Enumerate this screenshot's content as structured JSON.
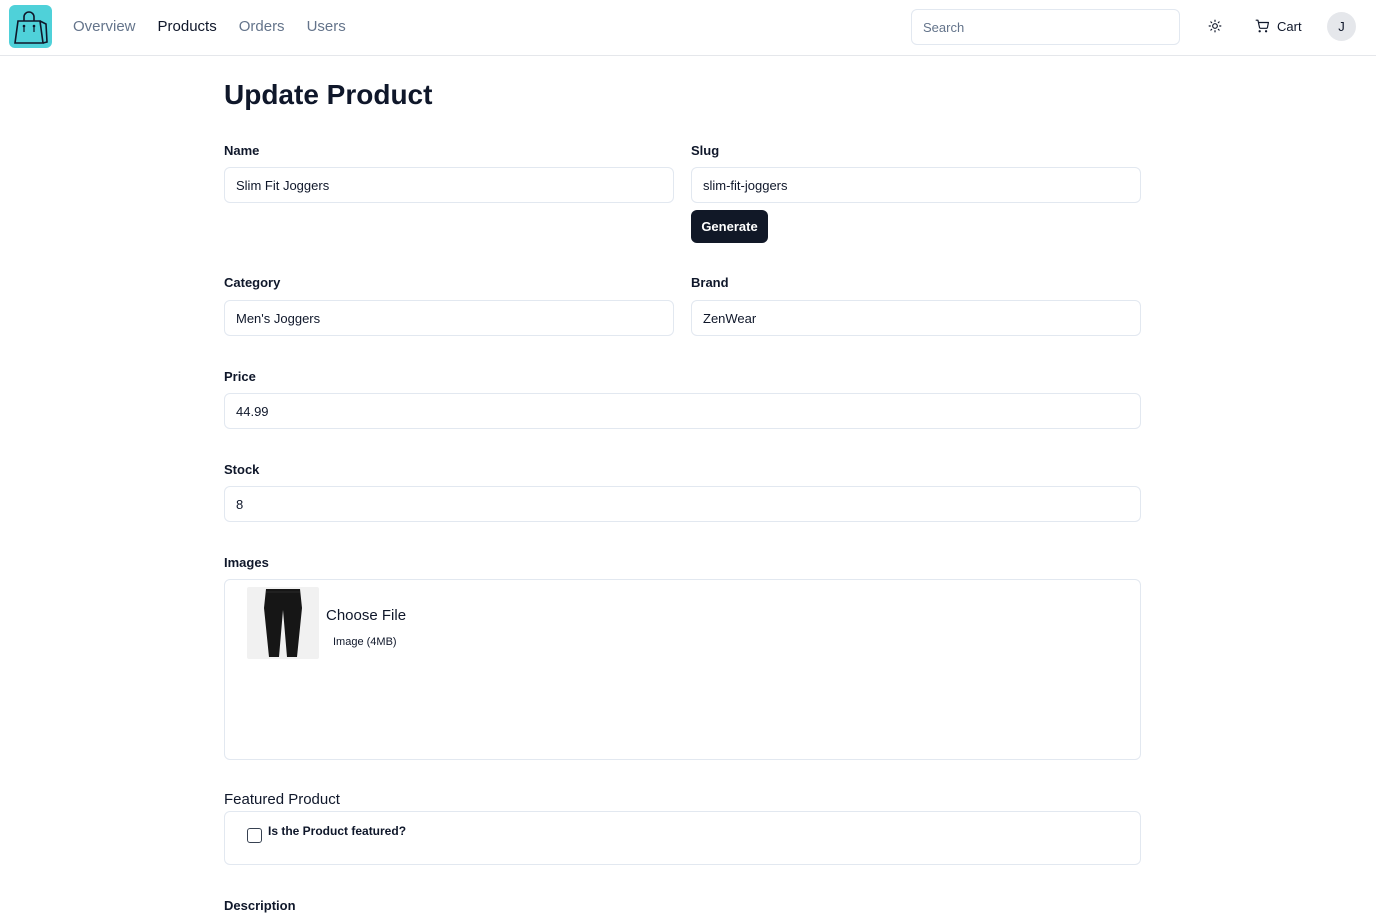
{
  "header": {
    "nav": [
      {
        "label": "Overview",
        "active": false
      },
      {
        "label": "Products",
        "active": true
      },
      {
        "label": "Orders",
        "active": false
      },
      {
        "label": "Users",
        "active": false
      }
    ],
    "search_placeholder": "Search",
    "cart_label": "Cart",
    "avatar_initial": "J",
    "logo_color": "#4fd1d9",
    "icons": {
      "logo": "shopping-bag-icon",
      "theme": "sun-icon",
      "cart": "cart-icon"
    }
  },
  "form": {
    "title": "Update Product",
    "name": {
      "label": "Name",
      "value": "Slim Fit Joggers"
    },
    "slug": {
      "label": "Slug",
      "value": "slim-fit-joggers",
      "generate_label": "Generate"
    },
    "category": {
      "label": "Category",
      "value": "Men's Joggers"
    },
    "brand": {
      "label": "Brand",
      "value": "ZenWear"
    },
    "price": {
      "label": "Price",
      "value": "44.99"
    },
    "stock": {
      "label": "Stock",
      "value": "8"
    },
    "images": {
      "label": "Images",
      "choose_label": "Choose File",
      "hint": "Image (4MB)"
    },
    "featured": {
      "title": "Featured Product",
      "checkbox_label": "Is the Product featured?",
      "checked": false
    },
    "description": {
      "label": "Description"
    }
  },
  "colors": {
    "primary_button": "#111827",
    "border": "#e2e8f0",
    "muted_text": "#64748b"
  }
}
